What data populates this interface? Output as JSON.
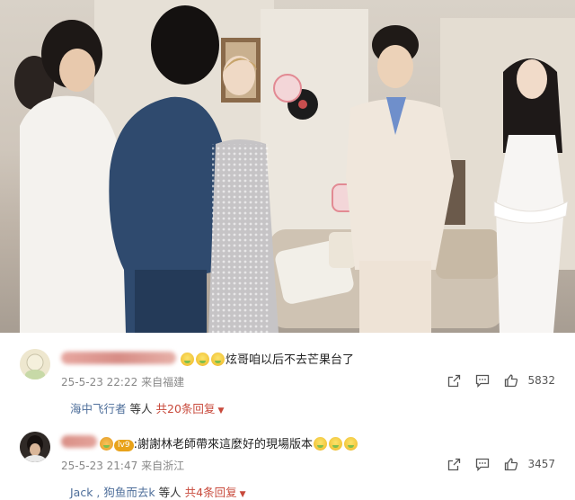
{
  "comments": [
    {
      "text": "炫哥咱以后不去芒果台了",
      "time": "25-5-23 22:22",
      "location": "来自福建",
      "replies": {
        "names": "海中飞行者",
        "connector": "等人",
        "count_label": "共20条回复"
      },
      "likes": "5832"
    },
    {
      "text": ":謝謝林老師帶來這麼好的現場版本",
      "time": "25-5-23 21:47",
      "location": "来自浙江",
      "badge": "lv9",
      "replies": {
        "names": "Jack , 狗鱼而去k",
        "connector": "等人",
        "count_label": "共4条回复"
      },
      "likes": "3457"
    }
  ],
  "icons": {
    "share": "share-icon",
    "comment": "comment-icon",
    "like": "thumbs-up-icon",
    "more": "chevron-down-icon"
  },
  "colors": {
    "reply_name": "#4f6f9b",
    "reply_count": "#c8493b",
    "meta": "#888888"
  }
}
